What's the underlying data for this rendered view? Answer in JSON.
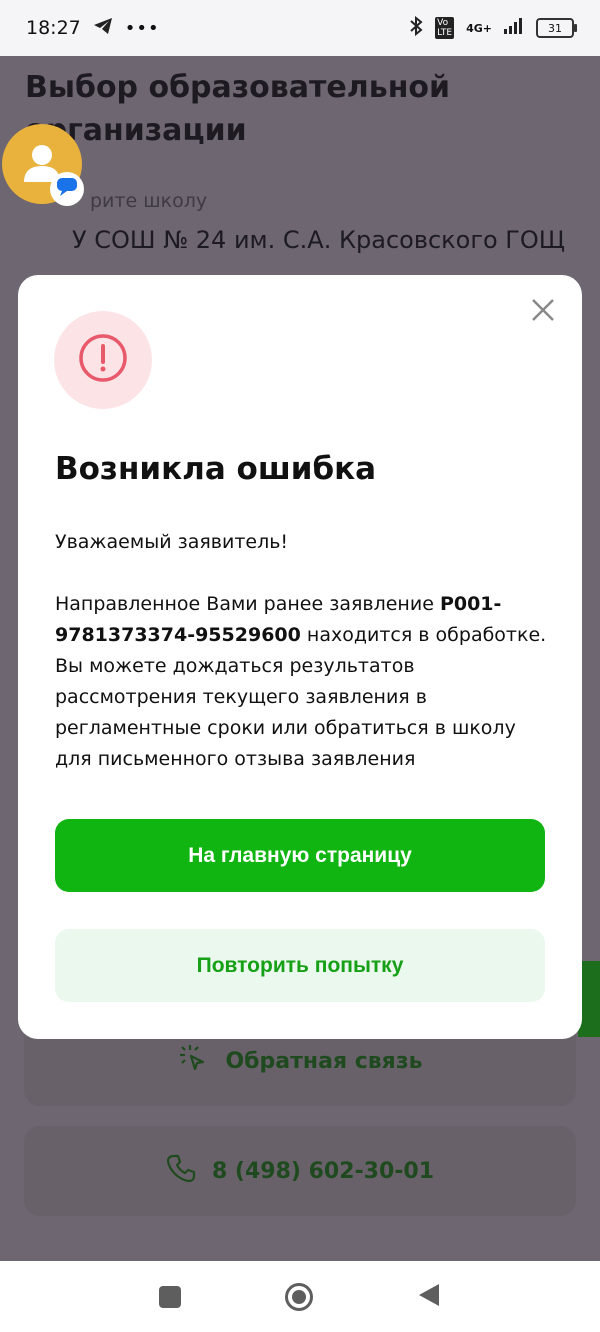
{
  "statusbar": {
    "time": "18:27",
    "battery": "31",
    "network": "4G+"
  },
  "page": {
    "title": "Выбор образовательной организации",
    "field_label": "рите школу",
    "field_value": "У СОШ № 24 им. С.А. Красовского ГОЩ",
    "feedback_label": "Обратная связь",
    "phone": "8 (498) 602-30-01"
  },
  "modal": {
    "title": "Возникла ошибка",
    "greeting": "Уважаемый заявитель!",
    "body_before": "Направленное Вами ранее заявление ",
    "application_id": "P001-9781373374-95529600",
    "body_after": " находится в обработке. Вы можете дождаться результатов рассмотрения текущего заявления в регламентные сроки или обратиться в школу для письменного отзыва заявления",
    "primary_button": "На главную страницу",
    "secondary_button": "Повторить попытку"
  },
  "icons": {
    "close": "close-icon",
    "alert": "exclamation-icon",
    "telegram": "telegram-icon",
    "bluetooth": "bluetooth-icon"
  },
  "colors": {
    "primary_green": "#10b511",
    "secondary_bg": "#eaf8ee",
    "alert_red": "#e85a6b",
    "overlay": "#6e6670"
  }
}
